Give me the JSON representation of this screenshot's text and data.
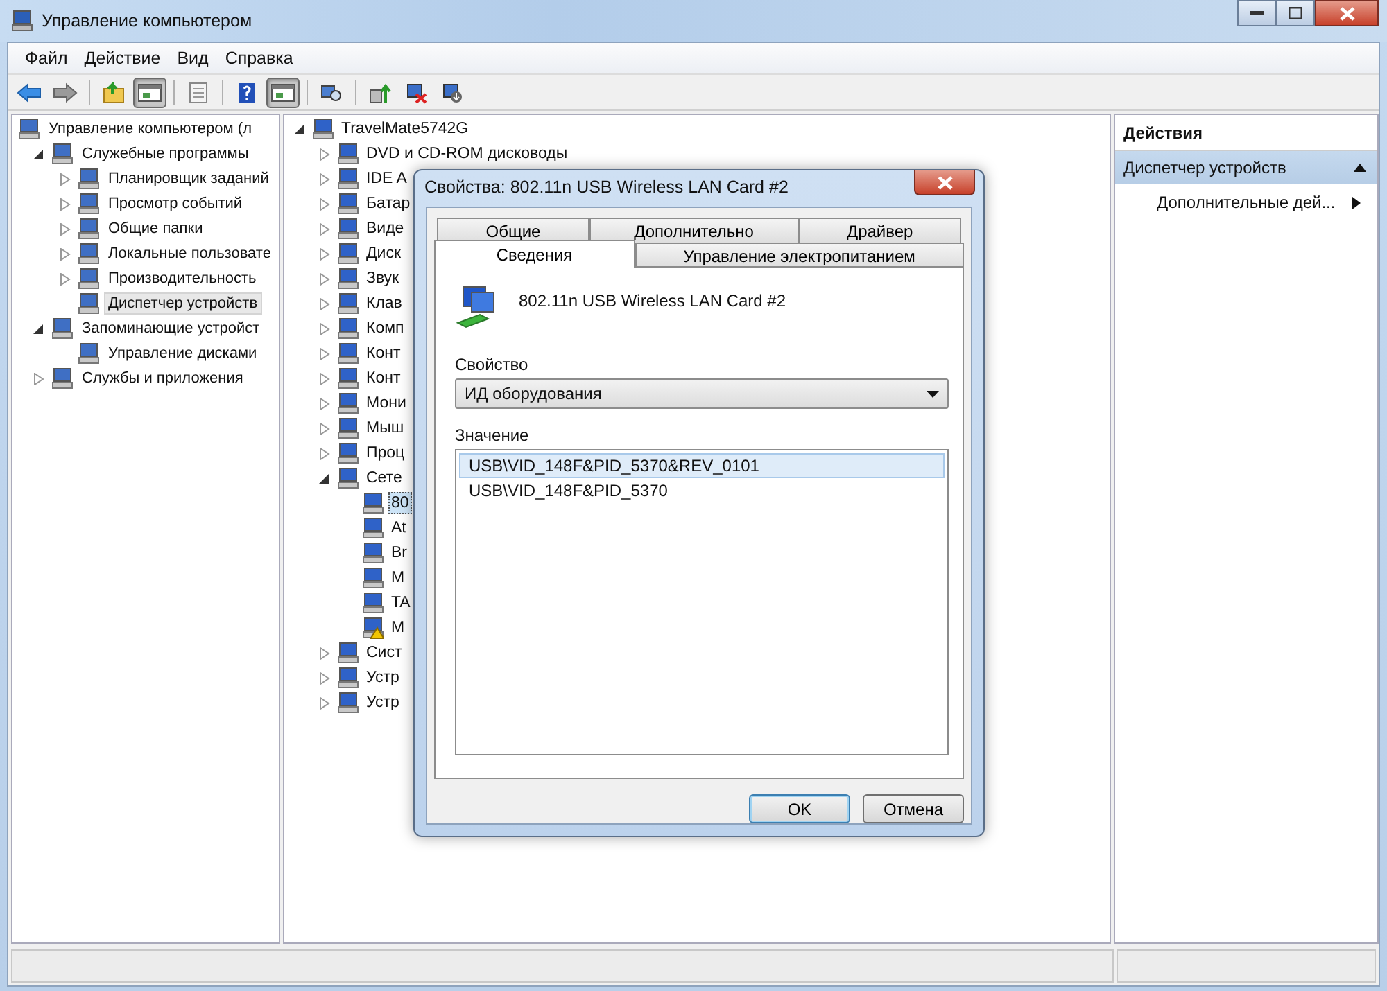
{
  "window": {
    "title": "Управление компьютером"
  },
  "menu": [
    "Файл",
    "Действие",
    "Вид",
    "Справка"
  ],
  "toolbar": [
    {
      "kind": "back",
      "pressed": false
    },
    {
      "kind": "forward",
      "pressed": false
    },
    {
      "kind": "separator"
    },
    {
      "kind": "folder-up",
      "pressed": false
    },
    {
      "kind": "pane",
      "pressed": true
    },
    {
      "kind": "separator"
    },
    {
      "kind": "sheet",
      "pressed": false
    },
    {
      "kind": "separator"
    },
    {
      "kind": "help",
      "pressed": false
    },
    {
      "kind": "pane",
      "pressed": true
    },
    {
      "kind": "separator"
    },
    {
      "kind": "scan",
      "pressed": false
    },
    {
      "kind": "separator"
    },
    {
      "kind": "update",
      "pressed": false
    },
    {
      "kind": "remove",
      "pressed": false
    },
    {
      "kind": "install",
      "pressed": false
    }
  ],
  "nav_tree": [
    {
      "label": "Управление компьютером (л",
      "selected": false,
      "children": [
        {
          "label": "Служебные программы",
          "selected": false,
          "expanded": true,
          "children": [
            {
              "label": "Планировщик заданий",
              "selected": false,
              "expanded": false
            },
            {
              "label": "Просмотр событий",
              "selected": false,
              "expanded": false
            },
            {
              "label": "Общие папки",
              "selected": false,
              "expanded": false
            },
            {
              "label": "Локальные пользовате",
              "selected": false,
              "expanded": false
            },
            {
              "label": "Производительность",
              "selected": false,
              "expanded": false
            },
            {
              "label": "Диспетчер устройств",
              "selected": true
            }
          ]
        },
        {
          "label": "Запоминающие устройст",
          "selected": false,
          "expanded": true,
          "children": [
            {
              "label": "Управление дисками",
              "selected": false
            }
          ]
        },
        {
          "label": "Службы и приложения",
          "selected": false,
          "expanded": false
        }
      ]
    }
  ],
  "device_tree": [
    {
      "label": "TravelMate5742G",
      "selected": false,
      "expanded": true,
      "children": [
        {
          "label": "DVD и CD-ROM дисководы",
          "selected": false,
          "expanded": false
        },
        {
          "label": "IDE A",
          "selected": false,
          "expanded": false
        },
        {
          "label": "Батар",
          "selected": false,
          "expanded": false
        },
        {
          "label": "Виде",
          "selected": false,
          "expanded": false
        },
        {
          "label": "Диск",
          "selected": false,
          "expanded": false
        },
        {
          "label": "Звук",
          "selected": false,
          "expanded": false
        },
        {
          "label": "Клав",
          "selected": false,
          "expanded": false
        },
        {
          "label": "Комп",
          "selected": false,
          "expanded": false
        },
        {
          "label": "Конт",
          "selected": false,
          "expanded": false
        },
        {
          "label": "Конт",
          "selected": false,
          "expanded": false
        },
        {
          "label": "Мони",
          "selected": false,
          "expanded": false
        },
        {
          "label": "Мыш",
          "selected": false,
          "expanded": false
        },
        {
          "label": "Проц",
          "selected": false,
          "expanded": false
        },
        {
          "label": "Сете",
          "selected": false,
          "expanded": true,
          "children": [
            {
              "label": "80",
              "selected": true,
              "warning": false
            },
            {
              "label": "At",
              "selected": false,
              "warning": false
            },
            {
              "label": "Br",
              "selected": false,
              "warning": false
            },
            {
              "label": "M",
              "selected": false,
              "warning": false
            },
            {
              "label": "TA",
              "selected": false,
              "warning": false
            },
            {
              "label": "M",
              "selected": false,
              "warning": true
            }
          ]
        },
        {
          "label": "Сист",
          "selected": false,
          "expanded": false
        },
        {
          "label": "Устр",
          "selected": false,
          "expanded": false
        },
        {
          "label": "Устр",
          "selected": false,
          "expanded": false
        }
      ]
    }
  ],
  "actions": {
    "header": "Действия",
    "section": {
      "label": "Диспетчер устройств",
      "expanded": true
    },
    "items": [
      "Дополнительные дей..."
    ]
  },
  "dialog": {
    "title": "Свойства: 802.11n USB Wireless LAN Card #2",
    "tab_rows": [
      [
        {
          "label": "Общие",
          "selected": false
        },
        {
          "label": "Дополнительно",
          "selected": false
        },
        {
          "label": "Драйвер",
          "selected": false
        }
      ],
      [
        {
          "label": "Сведения",
          "selected": true
        },
        {
          "label": "Управление электропитанием",
          "selected": false
        }
      ]
    ],
    "device_name": "802.11n USB Wireless LAN Card #2",
    "property_label": "Свойство",
    "property_value": "ИД оборудования",
    "value_label": "Значение",
    "values": [
      {
        "text": "USB\\VID_148F&PID_5370&REV_0101",
        "selected": true
      },
      {
        "text": "USB\\VID_148F&PID_5370",
        "selected": false
      }
    ],
    "buttons": [
      {
        "label": "OK",
        "default": true
      },
      {
        "label": "Отмена",
        "default": false
      }
    ]
  }
}
